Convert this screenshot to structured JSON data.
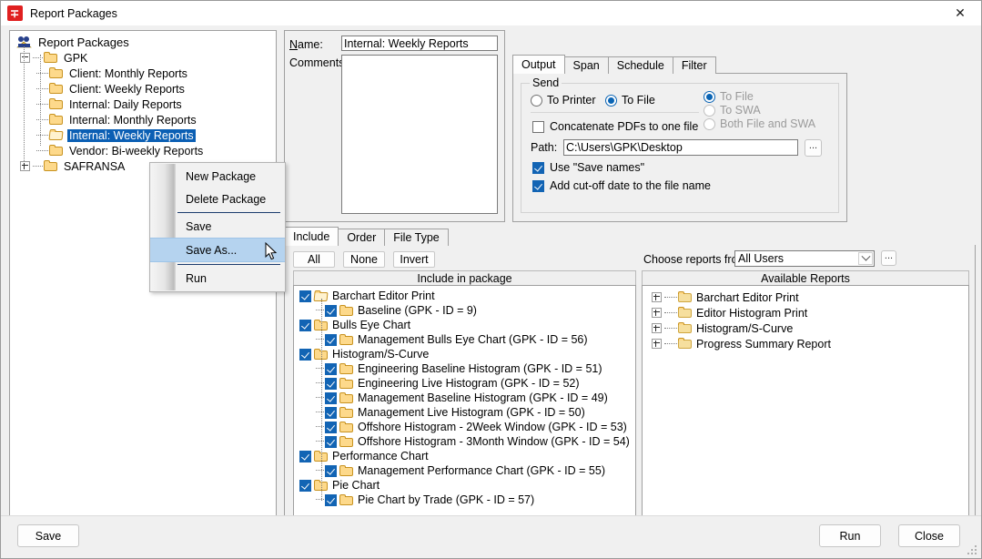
{
  "window": {
    "title": "Report Packages",
    "app_icon": "report-packages-icon",
    "close_label": "✕"
  },
  "tree_panel": {
    "root_label": "Report Packages",
    "nodes": [
      {
        "label": "GPK",
        "level": 1,
        "expander": "minus",
        "icon": "folder-closed-icon",
        "selected": false
      },
      {
        "label": "Client: Monthly Reports",
        "level": 2,
        "expander": "none",
        "icon": "folder-closed-icon",
        "selected": false
      },
      {
        "label": "Client: Weekly Reports",
        "level": 2,
        "expander": "none",
        "icon": "folder-closed-icon",
        "selected": false
      },
      {
        "label": "Internal: Daily Reports",
        "level": 2,
        "expander": "none",
        "icon": "folder-closed-icon",
        "selected": false
      },
      {
        "label": "Internal: Monthly Reports",
        "level": 2,
        "expander": "none",
        "icon": "folder-closed-icon",
        "selected": false
      },
      {
        "label": "Internal: Weekly Reports",
        "level": 2,
        "expander": "none",
        "icon": "folder-open-icon",
        "selected": true
      },
      {
        "label": "Vendor: Bi-weekly Reports",
        "level": 2,
        "expander": "none",
        "icon": "folder-closed-icon",
        "selected": false
      },
      {
        "label": "SAFRANSA",
        "level": 1,
        "expander": "plus",
        "icon": "folder-closed-icon",
        "selected": false
      }
    ]
  },
  "context_menu": {
    "items": [
      {
        "label": "New Package",
        "highlighted": false,
        "separator_after": false
      },
      {
        "label": "Delete Package",
        "highlighted": false,
        "separator_after": true
      },
      {
        "label": "Save",
        "highlighted": false,
        "separator_after": false
      },
      {
        "label": "Save As...",
        "highlighted": true,
        "separator_after": true
      },
      {
        "label": "Run",
        "highlighted": false,
        "separator_after": false
      }
    ]
  },
  "details": {
    "name_label": "Name:",
    "name_value": "Internal: Weekly Reports",
    "comments_label": "Comments:",
    "comments_value": ""
  },
  "right_tabs": {
    "tabs": [
      {
        "label": "Output",
        "active": true
      },
      {
        "label": "Span",
        "active": false
      },
      {
        "label": "Schedule",
        "active": false
      },
      {
        "label": "Filter",
        "active": false
      }
    ]
  },
  "output": {
    "group_title": "Send",
    "send_options": [
      {
        "label": "To Printer",
        "selected": false,
        "disabled": false
      },
      {
        "label": "To File",
        "selected": true,
        "disabled": false
      }
    ],
    "destination_options": [
      {
        "label": "To File",
        "selected": true,
        "disabled": true
      },
      {
        "label": "To SWA",
        "selected": false,
        "disabled": true
      },
      {
        "label": "Both File and SWA",
        "selected": false,
        "disabled": true
      }
    ],
    "concatenate_label": "Concatenate PDFs to one file",
    "concatenate_checked": false,
    "path_label": "Path:",
    "path_value": "C:\\Users\\GPK\\Desktop",
    "browse_label": "...",
    "use_save_names_label": "Use \"Save names\"",
    "use_save_names_checked": true,
    "cutoff_label": "Add cut-off date to the file name",
    "cutoff_checked": true
  },
  "lower_tabs": {
    "tabs": [
      {
        "label": "Include",
        "active": true
      },
      {
        "label": "Order",
        "active": false
      },
      {
        "label": "File Type",
        "active": false
      }
    ]
  },
  "include_toolbar": {
    "all_label": "All",
    "none_label": "None",
    "invert_label": "Invert",
    "choose_label": "Choose reports from:",
    "choose_value": "All Users",
    "choose_browse_label": "..."
  },
  "include_panel": {
    "header": "Include in package",
    "rows": [
      {
        "label": "Barchart Editor Print",
        "level": 0,
        "checked": true,
        "icon": "folder-open-icon"
      },
      {
        "label": "Baseline  (GPK - ID = 9)",
        "level": 1,
        "checked": true,
        "icon": "folder-closed-icon"
      },
      {
        "label": "Bulls Eye Chart",
        "level": 0,
        "checked": true,
        "icon": "folder-closed-icon"
      },
      {
        "label": "Management Bulls Eye Chart  (GPK - ID = 56)",
        "level": 1,
        "checked": true,
        "icon": "folder-closed-icon"
      },
      {
        "label": "Histogram/S-Curve",
        "level": 0,
        "checked": true,
        "icon": "folder-closed-icon"
      },
      {
        "label": "Engineering Baseline Histogram  (GPK - ID = 51)",
        "level": 1,
        "checked": true,
        "icon": "folder-closed-icon"
      },
      {
        "label": "Engineering Live Histogram  (GPK - ID = 52)",
        "level": 1,
        "checked": true,
        "icon": "folder-closed-icon"
      },
      {
        "label": "Management Baseline Histogram  (GPK - ID = 49)",
        "level": 1,
        "checked": true,
        "icon": "folder-closed-icon"
      },
      {
        "label": "Management Live Histogram  (GPK - ID = 50)",
        "level": 1,
        "checked": true,
        "icon": "folder-closed-icon"
      },
      {
        "label": "Offshore Histogram - 2Week Window  (GPK - ID = 53)",
        "level": 1,
        "checked": true,
        "icon": "folder-closed-icon"
      },
      {
        "label": "Offshore Histogram - 3Month Window  (GPK - ID = 54)",
        "level": 1,
        "checked": true,
        "icon": "folder-closed-icon"
      },
      {
        "label": "Performance Chart",
        "level": 0,
        "checked": true,
        "icon": "folder-closed-icon"
      },
      {
        "label": "Management Performance Chart  (GPK - ID = 55)",
        "level": 1,
        "checked": true,
        "icon": "folder-closed-icon"
      },
      {
        "label": "Pie Chart",
        "level": 0,
        "checked": true,
        "icon": "folder-closed-icon"
      },
      {
        "label": "Pie Chart by Trade  (GPK - ID = 57)",
        "level": 1,
        "checked": true,
        "icon": "folder-closed-icon"
      }
    ]
  },
  "available_panel": {
    "header": "Available Reports",
    "rows": [
      {
        "label": "Barchart Editor Print",
        "expander": "plus",
        "icon": "folder-closed-icon"
      },
      {
        "label": "Editor Histogram Print",
        "expander": "plus",
        "icon": "folder-closed-icon"
      },
      {
        "label": "Histogram/S-Curve",
        "expander": "plus",
        "icon": "folder-closed-icon"
      },
      {
        "label": "Progress Summary Report",
        "expander": "plus",
        "icon": "folder-closed-icon"
      }
    ]
  },
  "footer": {
    "save_label": "Save",
    "run_label": "Run",
    "close_label": "Close"
  },
  "colors": {
    "selection_blue": "#0b5fb4",
    "menu_highlight": "#b5d3ef",
    "checkbox_blue": "#1264b4",
    "app_icon_red": "#e02020"
  }
}
